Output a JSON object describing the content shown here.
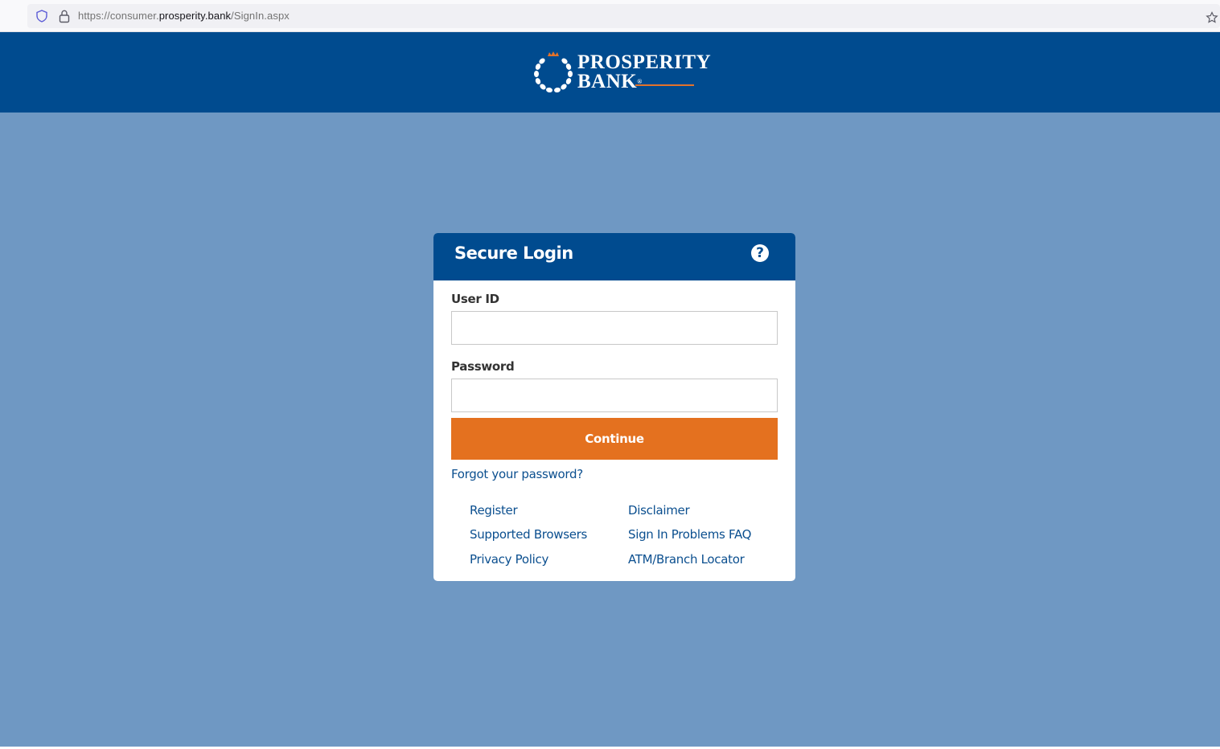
{
  "browser": {
    "url_prefix": "https://consumer.",
    "url_domain": "prosperity.bank",
    "url_path": "/SignIn.aspx"
  },
  "header": {
    "logo_line1": "PROSPERITY",
    "logo_line2": "BANK",
    "logo_reg": "®"
  },
  "login": {
    "title": "Secure Login",
    "help_icon_glyph": "?",
    "user_label": "User ID",
    "user_value": "",
    "password_label": "Password",
    "password_value": "",
    "continue_label": "Continue",
    "forgot_label": "Forgot your password?"
  },
  "links": {
    "register": "Register",
    "disclaimer": "Disclaimer",
    "supported_browsers": "Supported Browsers",
    "sign_in_faq": "Sign In Problems FAQ",
    "privacy_policy": "Privacy Policy",
    "atm_locator": "ATM/Branch Locator"
  },
  "colors": {
    "brand_blue": "#004b8f",
    "background": "#6f98c3",
    "accent_orange": "#e4711f"
  }
}
